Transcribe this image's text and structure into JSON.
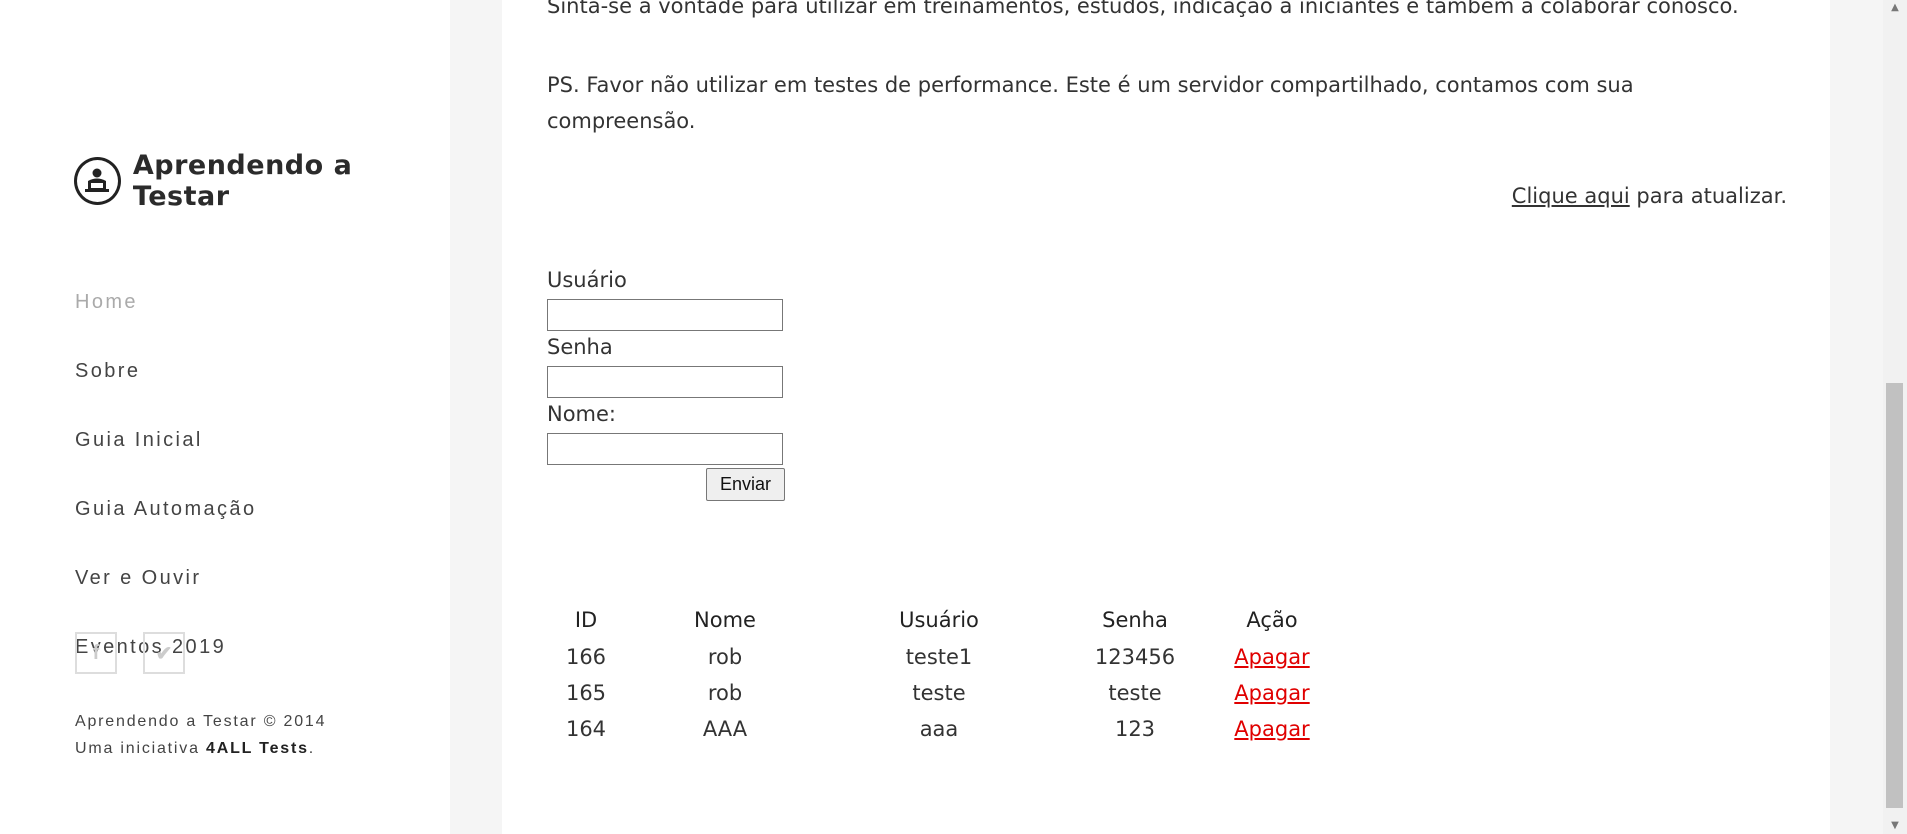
{
  "sidebar": {
    "logo_text": "Aprendendo a Testar",
    "nav": [
      {
        "label": "Home",
        "active": true
      },
      {
        "label": "Sobre"
      },
      {
        "label": "Guia Inicial"
      },
      {
        "label": "Guia Automação"
      },
      {
        "label": "Ver e Ouvir"
      },
      {
        "label": "Eventos 2019"
      }
    ],
    "social": {
      "facebook": "f",
      "twitter": "✔"
    },
    "footer": {
      "line1": "Aprendendo a Testar © 2014",
      "line2_prefix": "Uma iniciativa ",
      "line2_bold": "4ALL Tests",
      "line2_suffix": "."
    }
  },
  "content": {
    "paragraph1": "Sinta-se à vontade para utilizar em treinamentos, estudos, indicação a iniciantes e também a colaborar conosco.",
    "paragraph2": "PS. Favor não utilizar em testes de performance. Este é um servidor compartilhado, contamos com sua compreensão.",
    "refresh_link": "Clique aqui",
    "refresh_suffix": " para atualizar."
  },
  "form": {
    "usuario_label": "Usuário",
    "usuario_value": "",
    "senha_label": "Senha",
    "senha_value": "",
    "nome_label": "Nome:",
    "nome_value": "",
    "submit_label": "Enviar"
  },
  "table": {
    "headers": [
      "ID",
      "Nome",
      "Usuário",
      "Senha",
      "Ação"
    ],
    "rows": [
      {
        "id": "166",
        "nome": "rob",
        "usuario": "teste1",
        "senha": "123456",
        "acao": "Apagar"
      },
      {
        "id": "165",
        "nome": "rob",
        "usuario": "teste",
        "senha": "teste",
        "acao": "Apagar"
      },
      {
        "id": "164",
        "nome": "AAA",
        "usuario": "aaa",
        "senha": "123",
        "acao": "Apagar"
      }
    ]
  },
  "colors": {
    "link_red": "#e00000",
    "active_nav": "#aaaaaa",
    "text": "#333333"
  }
}
